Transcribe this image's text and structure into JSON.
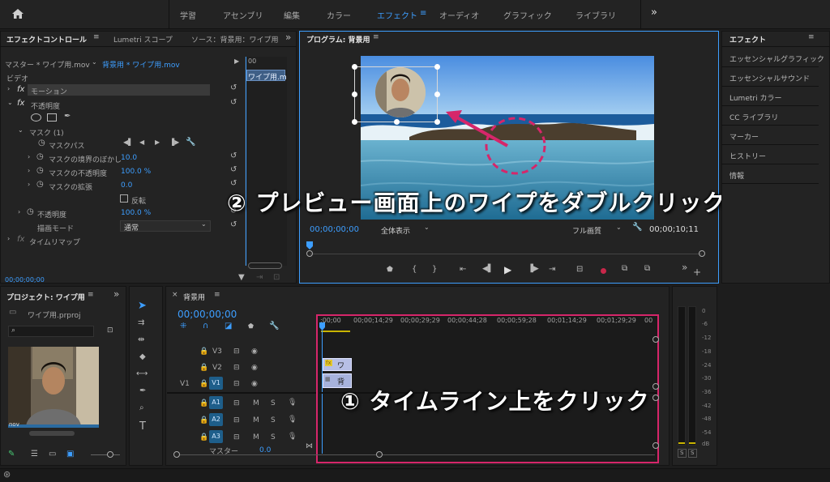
{
  "top_nav": {
    "items": [
      "学習",
      "アセンブリ",
      "編集",
      "カラー",
      "エフェクト",
      "オーディオ",
      "グラフィック",
      "ライブラリ"
    ],
    "active": "エフェクト",
    "more": "»"
  },
  "effect_controls": {
    "tabs": [
      "エフェクトコントロール",
      "Lumetri スコープ",
      "ソース：背景用：ワイプ用"
    ],
    "master": "マスター * ワイプ用.mov",
    "clip": "背景用 * ワイプ用.mov",
    "clip_mini": "ワイプ用.m",
    "section_video": "ビデオ",
    "rows": {
      "motion": "モーション",
      "opacity": "不透明度",
      "mask": "マスク (1)",
      "mask_path": "マスクパス",
      "feather_label": "マスクの境界のぼかし",
      "feather_value": "10.0",
      "mask_opacity_label": "マスクの不透明度",
      "mask_opacity_value": "100.0 %",
      "expansion_label": "マスクの拡張",
      "expansion_value": "0.0",
      "inverted": "反転",
      "opacity2_label": "不透明度",
      "opacity2_value": "100.0 %",
      "blend_label": "描画モード",
      "blend_value": "通常",
      "time_remap": "タイムリマップ"
    },
    "fx": "fx",
    "time": "00;00;00;00",
    "ruler_time": "00"
  },
  "program": {
    "title": "プログラム: 背景用",
    "timecode": "00;00;00;00",
    "fit": "全体表示",
    "quality": "フル画質",
    "duration": "00;00;10;11"
  },
  "annotations": {
    "step2": "② プレビュー画面上のワイプをダブルクリック",
    "step1": "① タイムライン上をクリック"
  },
  "effects_panel": {
    "title": "エフェクト",
    "items": [
      "エッセンシャルグラフィック",
      "エッセンシャルサウンド",
      "Lumetri カラー",
      "CC ライブラリ",
      "マーカー",
      "ヒストリー",
      "情報"
    ]
  },
  "project": {
    "title": "プロジェクト: ワイプ用",
    "file": "ワイプ用.prproj",
    "thumb_label": "nov"
  },
  "timeline": {
    "tab": "背景用",
    "timecode": "00;00;00;00",
    "ruler": [
      ";00;00",
      "00;00;14;29",
      "00;00;29;29",
      "00;00;44;28",
      "00;00;59;28",
      "00;01;14;29",
      "00;01;29;29",
      "00"
    ],
    "video_tracks": [
      "V3",
      "V2",
      "V1"
    ],
    "source_v": "V1",
    "audio_tracks": [
      "A1",
      "A2",
      "A3"
    ],
    "master": "マスター",
    "master_value": "0.0",
    "clip_top": "ワ",
    "clip_bottom": "背",
    "m_label": "M",
    "s_label": "S"
  },
  "audio_meter": {
    "labels": [
      "0",
      "-6",
      "-12",
      "-18",
      "-24",
      "-30",
      "-36",
      "-42",
      "-48",
      "-54",
      "dB"
    ],
    "solo": [
      "S",
      "S"
    ]
  },
  "colors": {
    "accent": "#3d9eff",
    "annotation": "#d6266a",
    "track_blue": "#1e5e8a"
  }
}
